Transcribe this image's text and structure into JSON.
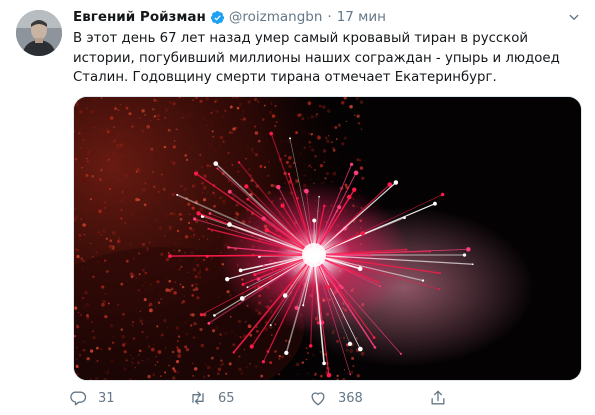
{
  "tweet": {
    "author_name": "Евгений Ройзман",
    "handle": "@roizmangbn",
    "separator": "·",
    "time": "17 мин",
    "text": "В этот день 67 лет назад умер самый кровавый тиран в русской истории, погубивший миллионы наших сограждан - упырь и людоед Сталин. Годовщину смерти тирана отмечает Екатеринбург.",
    "verified": true
  },
  "media": {
    "icon": "fireworks-photo"
  },
  "actions": {
    "reply_count": "31",
    "retweet_count": "65",
    "like_count": "368"
  },
  "colors": {
    "text": "#14171a",
    "muted": "#657786",
    "verified": "#1da1f2"
  }
}
